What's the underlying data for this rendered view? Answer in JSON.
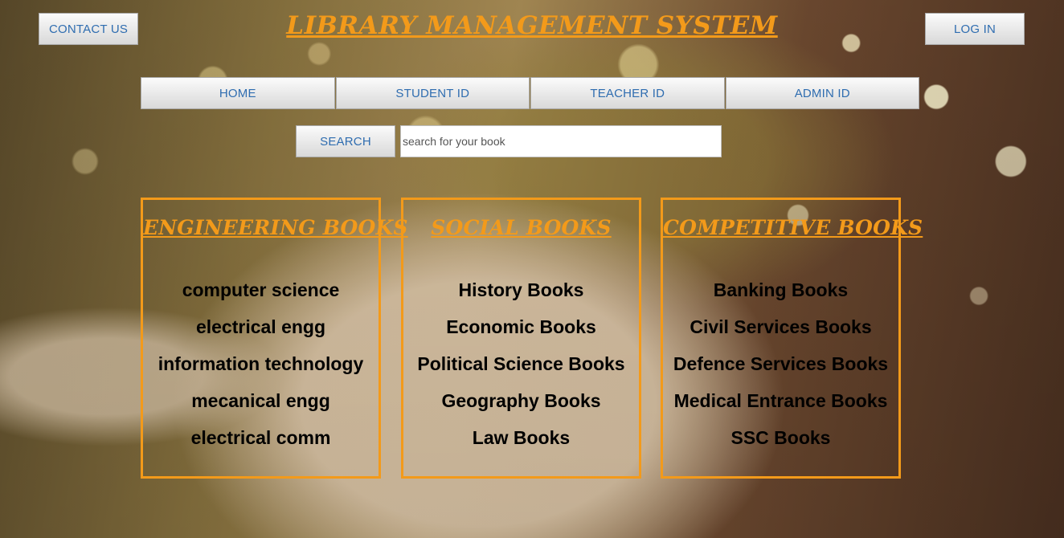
{
  "header": {
    "title": "LIBRARY MANAGEMENT SYSTEM",
    "contact_label": "CONTACT US",
    "login_label": "LOG IN"
  },
  "nav": {
    "items": [
      {
        "label": "HOME"
      },
      {
        "label": "STUDENT ID"
      },
      {
        "label": "TEACHER ID"
      },
      {
        "label": "ADMIN ID"
      }
    ]
  },
  "search": {
    "button_label": "SEARCH",
    "placeholder": "search for your book",
    "value": ""
  },
  "categories": [
    {
      "title": "ENGINEERING BOOKS",
      "items": [
        "computer science",
        "electrical engg",
        "information technology",
        "mecanical engg",
        "electrical comm"
      ]
    },
    {
      "title": "SOCIAL BOOKS",
      "items": [
        "History Books",
        "Economic Books",
        "Political Science Books",
        "Geography Books",
        "Law Books"
      ]
    },
    {
      "title": "COMPETITIVE BOOKS",
      "items": [
        "Banking Books",
        "Civil Services Books",
        "Defence Services Books",
        "Medical Entrance Books",
        "SSC Books"
      ]
    }
  ],
  "colors": {
    "accent": "#f39a1a",
    "button_text": "#2f6db0",
    "list_text": "#000000"
  }
}
